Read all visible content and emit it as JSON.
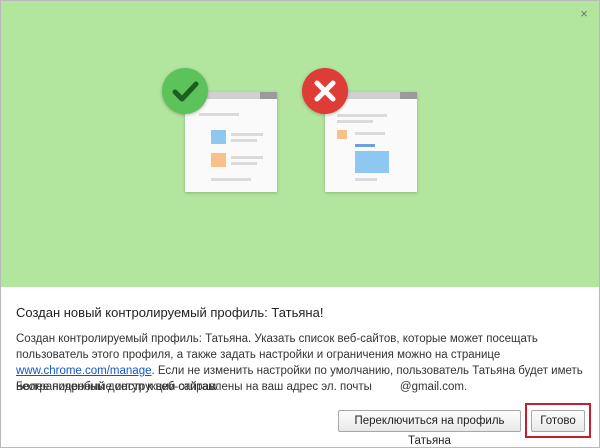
{
  "dialog": {
    "close_glyph": "×",
    "title": "Создан новый контролируемый профиль: Татьяна!",
    "description_before_link": "Создан контролируемый профиль: Татьяна. Указать список веб-сайтов, которые может посещать пользователь этого профиля, а также задать настройки и ограничения можно на странице ",
    "link": "www.chrome.com/manage",
    "description_after_link": ". Если не изменить настройки по умолчанию, пользователь Татьяна будет иметь неограниченный доступ к веб-сайтам.",
    "email_text": "Более подробные инструкции отправлены на ваш адрес эл. почты",
    "email_suffix": "@gmail.com.",
    "switch_button": "Переключиться на профиль Татьяна",
    "done_button": "Готово"
  },
  "illustration": {
    "left_badge_icon": "checkmark-icon",
    "right_badge_icon": "cross-icon",
    "colors": {
      "background": "#b2e59e",
      "ok_badge": "#5cc35a",
      "no_badge": "#df3b37",
      "blue_block": "#8ec8f0",
      "orange_block": "#f8c08a",
      "highlight": "#c41f2b"
    }
  }
}
